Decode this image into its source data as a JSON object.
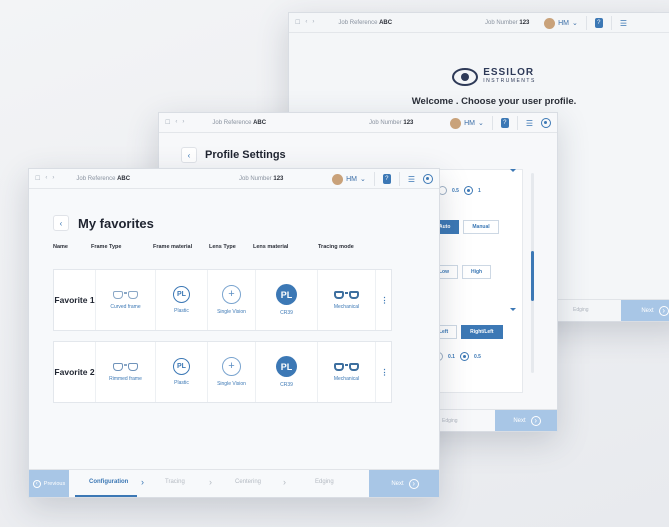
{
  "windows": {
    "back": {
      "nav": [
        "☐",
        "‹",
        "›"
      ],
      "job_reference_label": "Job Reference",
      "job_reference_value": "ABC",
      "job_number_label": "Job Number",
      "job_number_value": "123",
      "user": "HM",
      "brand": "ESSILOR",
      "brand_sub": "INSTRUMENTS",
      "welcome": "Welcome . Choose your user profile.",
      "edging": "Edging",
      "next": "Next"
    },
    "middle": {
      "job_reference_label": "Job Reference",
      "job_reference_value": "ABC",
      "job_number_label": "Job Number",
      "job_number_value": "123",
      "user": "HM",
      "title": "Profile Settings",
      "radio1_a": "0.5",
      "radio1_b": "1",
      "seg1_a": "Auto",
      "seg1_b": "Manual",
      "seg2_a": "Low",
      "seg2_b": "High",
      "seg3_a": "Left",
      "seg3_b": "Right/Left",
      "radio2_a": "0.1",
      "radio2_b": "0.5",
      "edging": "Edging",
      "next": "Next"
    },
    "front": {
      "job_reference_label": "Job Reference",
      "job_reference_value": "ABC",
      "job_number_label": "Job Number",
      "job_number_value": "123",
      "user": "HM",
      "title": "My favorites",
      "columns": {
        "name": "Name",
        "frame_type": "Frame Type",
        "frame_material": "Frame material",
        "lens_type": "Lens Type",
        "lens_material": "Lens material",
        "tracing_mode": "Tracing mode"
      },
      "favorites": [
        {
          "name": "Favorite 1",
          "frame_type": "Curved frame",
          "frame_material_badge": "PL",
          "frame_material": "Plastic",
          "lens_type": "Single Vision",
          "lens_material_badge": "PL",
          "lens_material": "CR39",
          "tracing_mode": "Mechanical"
        },
        {
          "name": "Favorite 2",
          "frame_type": "Rimmed frame",
          "frame_material_badge": "PL",
          "frame_material": "Plastic",
          "lens_type": "Single Vision",
          "lens_material_badge": "PL",
          "lens_material": "CR39",
          "tracing_mode": "Mechanical"
        }
      ],
      "footer": {
        "previous": "Previous",
        "steps": [
          "Configuration",
          "Tracing",
          "Centering",
          "Edging"
        ],
        "next": "Next"
      }
    }
  },
  "colors": {
    "accent": "#3c78b5",
    "light_accent": "#a8c6e6",
    "text": "#2b2f38"
  }
}
